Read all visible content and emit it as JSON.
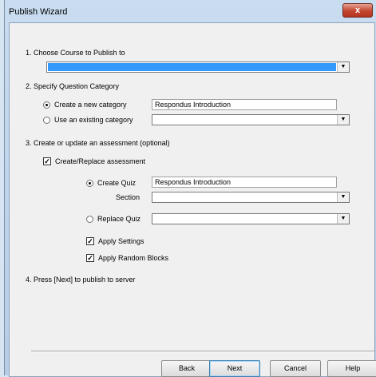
{
  "window": {
    "title": "Publish Wizard",
    "close_label": "x"
  },
  "step1": {
    "label": "1. Choose Course to Publish to",
    "course_value": ""
  },
  "step2": {
    "label": "2. Specify Question Category",
    "new_category_label": "Create a new category",
    "new_category_value": "Respondus Introduction",
    "existing_category_label": "Use an existing category",
    "existing_category_value": ""
  },
  "step3": {
    "label": "3. Create or update an assessment (optional)",
    "create_replace_label": "Create/Replace assessment",
    "create_quiz_label": "Create Quiz",
    "create_quiz_value": "Respondus Introduction",
    "section_label": "Section",
    "section_value": "",
    "replace_quiz_label": "Replace Quiz",
    "replace_quiz_value": "",
    "apply_settings_label": "Apply Settings",
    "apply_random_blocks_label": "Apply Random Blocks"
  },
  "step4": {
    "label": "4. Press [Next] to publish to server"
  },
  "buttons": {
    "back": "Back",
    "next": "Next",
    "cancel": "Cancel",
    "help": "Help"
  },
  "arrow_glyph": "▼",
  "check_glyph": "✓",
  "colors": {
    "selection": "#3399ff",
    "close": "#c2452f"
  }
}
